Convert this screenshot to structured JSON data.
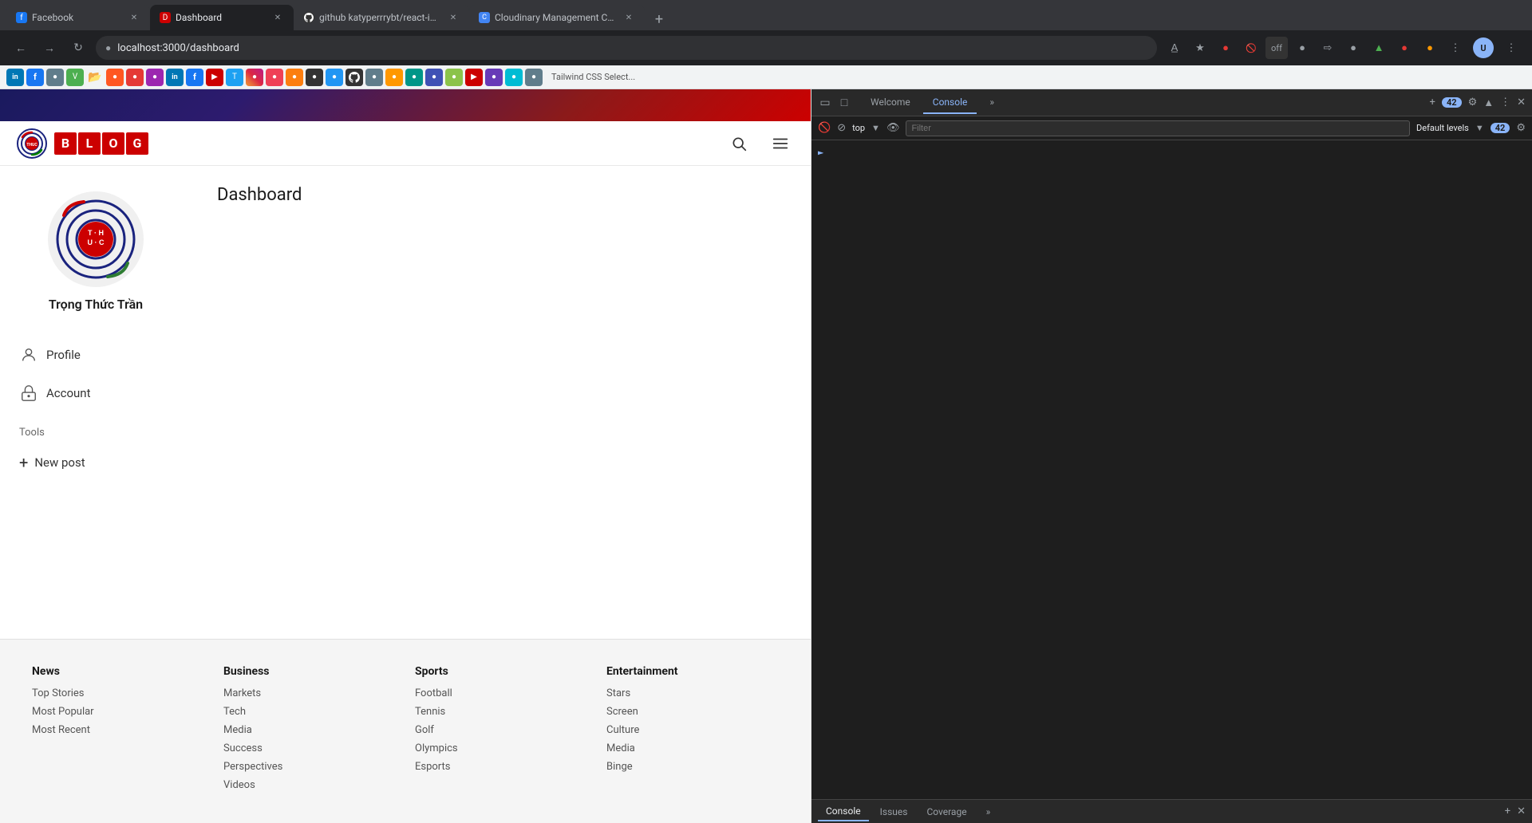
{
  "browser": {
    "tabs": [
      {
        "id": "tab-facebook",
        "favicon_color": "#1877f2",
        "favicon_letter": "f",
        "title": "Facebook",
        "active": false
      },
      {
        "id": "tab-dashboard",
        "favicon_letter": "D",
        "favicon_color": "#cc0000",
        "title": "Dashboard",
        "active": true
      },
      {
        "id": "tab-github",
        "favicon_letter": "G",
        "favicon_color": "#333",
        "title": "github katyperrrybt/react-image-uploa...",
        "active": false
      },
      {
        "id": "tab-cloudinary",
        "favicon_letter": "C",
        "favicon_color": "#4285f4",
        "title": "Cloudinary Management Consol...",
        "active": false
      }
    ],
    "address": "localhost:3000/dashboard",
    "new_tab_label": "+",
    "back_disabled": false,
    "forward_disabled": false
  },
  "devtools": {
    "tabs": [
      "Welcome",
      "Console",
      "»"
    ],
    "active_tab": "Console",
    "badge_count": "42",
    "filter_placeholder": "Filter",
    "levels_label": "Default levels",
    "levels_count": "42",
    "toolbar_buttons": [
      "top",
      "▾",
      "👁",
      "⊘"
    ],
    "bottom_tabs": [
      "Console",
      "Issues",
      "Coverage",
      "»"
    ],
    "active_bottom_tab": "Console",
    "close_label": "✕",
    "add_label": "+"
  },
  "app": {
    "header_gradient_visible": true,
    "logo": {
      "letters": [
        "B",
        "L",
        "O",
        "G"
      ]
    },
    "navbar": {
      "search_label": "🔍",
      "menu_label": "☰"
    },
    "dashboard": {
      "title": "Dashboard"
    },
    "sidebar": {
      "user_name": "Trọng Thức Trần",
      "nav_items": [
        {
          "id": "profile",
          "label": "Profile",
          "icon": "👤"
        },
        {
          "id": "account",
          "label": "Account",
          "icon": "🔐"
        }
      ],
      "tools_label": "Tools",
      "new_post_label": "New post"
    },
    "footer": {
      "columns": [
        {
          "title": "News",
          "links": [
            "Top Stories",
            "Most Popular",
            "Most Recent"
          ]
        },
        {
          "title": "Business",
          "links": [
            "Markets",
            "Tech",
            "Media",
            "Success",
            "Perspectives",
            "Videos"
          ]
        },
        {
          "title": "Sports",
          "links": [
            "Football",
            "Tennis",
            "Golf",
            "Olympics",
            "Esports"
          ]
        },
        {
          "title": "Entertainment",
          "links": [
            "Stars",
            "Screen",
            "Culture",
            "Media",
            "Binge"
          ]
        }
      ]
    }
  }
}
